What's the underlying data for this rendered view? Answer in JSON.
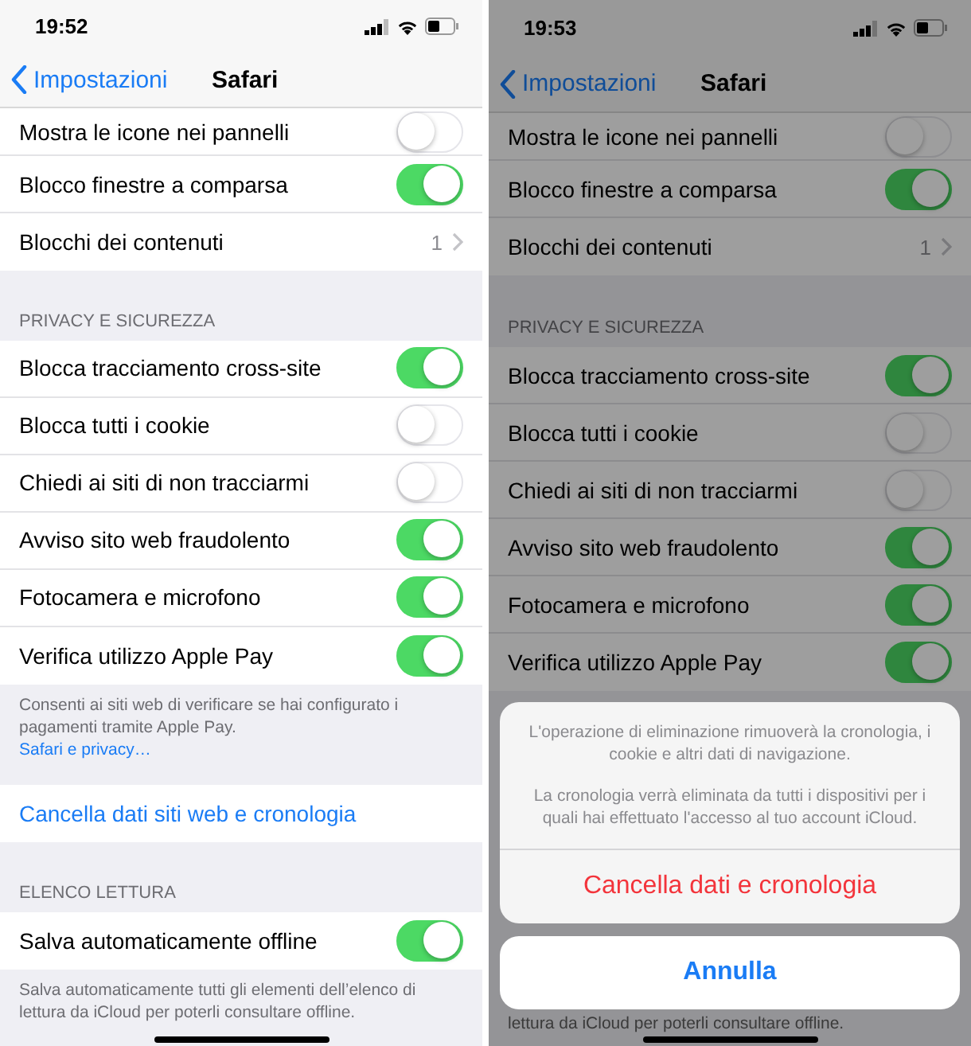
{
  "panels": [
    {
      "status_bar": {
        "time": "19:52"
      },
      "nav": {
        "back": "Impostazioni",
        "title": "Safari"
      },
      "dimmed": false,
      "sections": [
        {
          "rows": [
            {
              "kind": "toggle",
              "label": "Mostra le icone nei pannelli",
              "on": false
            },
            {
              "kind": "toggle",
              "label": "Blocco finestre a comparsa",
              "on": true
            },
            {
              "kind": "value",
              "label": "Blocchi dei contenuti",
              "value": "1"
            }
          ]
        },
        {
          "header": "PRIVACY E SICUREZZA",
          "rows": [
            {
              "kind": "toggle",
              "label": "Blocca tracciamento cross-site",
              "on": true
            },
            {
              "kind": "toggle",
              "label": "Blocca tutti i cookie",
              "on": false
            },
            {
              "kind": "toggle",
              "label": "Chiedi ai siti di non tracciarmi",
              "on": false
            },
            {
              "kind": "toggle",
              "label": "Avviso sito web fraudolento",
              "on": true
            },
            {
              "kind": "toggle",
              "label": "Fotocamera e microfono",
              "on": true
            },
            {
              "kind": "toggle",
              "label": "Verifica utilizzo Apple Pay",
              "on": true
            }
          ],
          "footer": {
            "text": "Consenti ai siti web di verificare se hai configurato i pagamenti tramite Apple Pay.",
            "link": "Safari e privacy…"
          }
        },
        {
          "rows": [
            {
              "kind": "action",
              "label": "Cancella dati siti web e cronologia"
            }
          ]
        },
        {
          "header": "ELENCO LETTURA",
          "rows": [
            {
              "kind": "toggle",
              "label": "Salva automaticamente offline",
              "on": true
            }
          ],
          "footer": {
            "text": "Salva automaticamente tutti gli elementi dell’elenco di lettura da iCloud per poterli consultare offline."
          }
        }
      ]
    },
    {
      "status_bar": {
        "time": "19:53"
      },
      "nav": {
        "back": "Impostazioni",
        "title": "Safari"
      },
      "dimmed": true,
      "sections": [
        {
          "rows": [
            {
              "kind": "toggle",
              "label": "Mostra le icone nei pannelli",
              "on": false
            },
            {
              "kind": "toggle",
              "label": "Blocco finestre a comparsa",
              "on": true
            },
            {
              "kind": "value",
              "label": "Blocchi dei contenuti",
              "value": "1"
            }
          ]
        },
        {
          "header": "PRIVACY E SICUREZZA",
          "rows": [
            {
              "kind": "toggle",
              "label": "Blocca tracciamento cross-site",
              "on": true
            },
            {
              "kind": "toggle",
              "label": "Blocca tutti i cookie",
              "on": false
            },
            {
              "kind": "toggle",
              "label": "Chiedi ai siti di non tracciarmi",
              "on": false
            },
            {
              "kind": "toggle",
              "label": "Avviso sito web fraudolento",
              "on": true
            },
            {
              "kind": "toggle",
              "label": "Fotocamera e microfono",
              "on": true
            },
            {
              "kind": "toggle",
              "label": "Verifica utilizzo Apple Pay",
              "on": true
            }
          ]
        }
      ],
      "action_sheet": {
        "message": [
          "L'operazione di eliminazione rimuoverà la cronologia, i cookie e altri dati di navigazione.",
          "La cronologia verrà eliminata da tutti i dispositivi per i quali hai effettuato l'accesso al tuo account iCloud."
        ],
        "destructive": "Cancella dati e cronologia",
        "cancel": "Annulla"
      },
      "bottom_text": "lettura da iCloud per poterli consultare offline."
    }
  ]
}
